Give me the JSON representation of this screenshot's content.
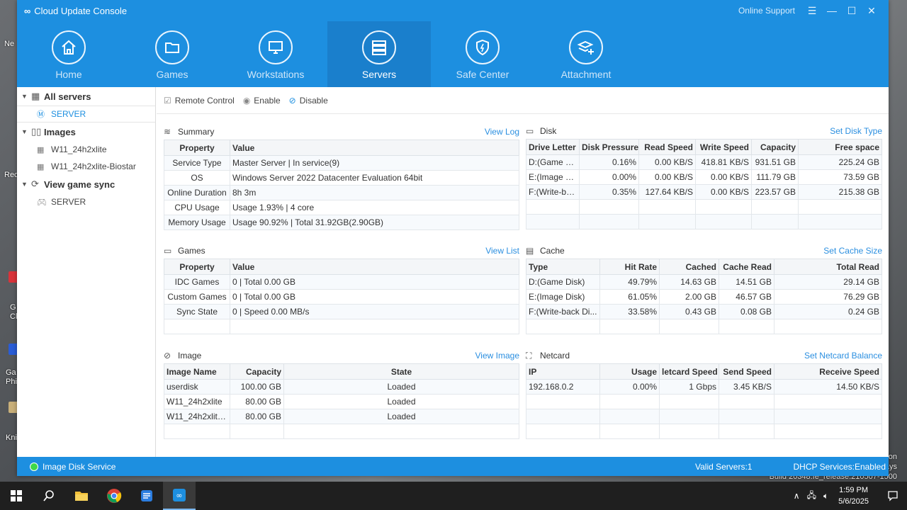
{
  "desktop": {
    "fragments": [
      "Ne",
      "Rec",
      "G",
      "Cl",
      "Ga",
      "Phi",
      "Kni"
    ],
    "watermark": [
      "tion",
      "days",
      "Build 20348.fe_release.210507-1500"
    ]
  },
  "titlebar": {
    "logo": "∞",
    "title": "Cloud Update Console",
    "support": "Online Support"
  },
  "nav": [
    {
      "label": "Home",
      "icon": "home-icon"
    },
    {
      "label": "Games",
      "icon": "folder-icon"
    },
    {
      "label": "Workstations",
      "icon": "monitor-icon"
    },
    {
      "label": "Servers",
      "icon": "server-icon"
    },
    {
      "label": "Safe Center",
      "icon": "shield-icon"
    },
    {
      "label": "Attachment",
      "icon": "layers-plus-icon"
    }
  ],
  "sidebar": {
    "groups": [
      {
        "label": "All servers",
        "items": [
          "SERVER"
        ]
      },
      {
        "label": "Images",
        "items": [
          "W11_24h2xlite",
          "W11_24h2xlite-Biostar"
        ]
      },
      {
        "label": "View game sync",
        "items": [
          "SERVER"
        ]
      }
    ]
  },
  "toolbar": {
    "remote": "Remote Control",
    "enable": "Enable",
    "disable": "Disable"
  },
  "summary": {
    "title": "Summary",
    "link": "View Log",
    "headers": [
      "Property",
      "Value"
    ],
    "rows": [
      [
        "Service Type",
        "Master Server | In service(9)"
      ],
      [
        "OS",
        "Windows Server 2022 Datacenter Evaluation 64bit"
      ],
      [
        "Online Duration",
        "8h 3m"
      ],
      [
        "CPU Usage",
        "Usage 1.93% | 4 core"
      ],
      [
        "Memory Usage",
        "Usage 90.92% | Total 31.92GB(2.90GB)"
      ]
    ]
  },
  "disk": {
    "title": "Disk",
    "link": "Set Disk Type",
    "headers": [
      "Drive Letter",
      "Disk Pressure",
      "Read Speed",
      "Write Speed",
      "Capacity",
      "Free space"
    ],
    "rows": [
      [
        "D:(Game D...",
        "0.16%",
        "0.00 KB/S",
        "418.81 KB/S",
        "931.51 GB",
        "225.24 GB"
      ],
      [
        "E:(Image D...",
        "0.00%",
        "0.00 KB/S",
        "0.00 KB/S",
        "111.79 GB",
        "73.59 GB"
      ],
      [
        "F:(Write-ba...",
        "0.35%",
        "127.64 KB/S",
        "0.00 KB/S",
        "223.57 GB",
        "215.38 GB"
      ]
    ]
  },
  "games": {
    "title": "Games",
    "link": "View List",
    "headers": [
      "Property",
      "Value"
    ],
    "rows": [
      [
        "IDC Games",
        "0 | Total 0.00 GB"
      ],
      [
        "Custom Games",
        "0 | Total 0.00 GB"
      ],
      [
        "Sync State",
        "0 | Speed 0.00 MB/s"
      ]
    ]
  },
  "cache": {
    "title": "Cache",
    "link": "Set Cache Size",
    "headers": [
      "Type",
      "Hit Rate",
      "Cached",
      "Cache Read",
      "Total Read"
    ],
    "rows": [
      [
        "D:(Game Disk)",
        "49.79%",
        "14.63 GB",
        "14.51 GB",
        "29.14 GB"
      ],
      [
        "E:(Image Disk)",
        "61.05%",
        "2.00 GB",
        "46.57 GB",
        "76.29 GB"
      ],
      [
        "F:(Write-back Di...",
        "33.58%",
        "0.43 GB",
        "0.08 GB",
        "0.24 GB"
      ]
    ]
  },
  "image": {
    "title": "Image",
    "link": "View Image",
    "headers": [
      "Image Name",
      "Capacity",
      "State"
    ],
    "rows": [
      [
        "userdisk",
        "100.00 GB",
        "Loaded"
      ],
      [
        "W11_24h2xlite",
        "80.00 GB",
        "Loaded"
      ],
      [
        "W11_24h2xlite...",
        "80.00 GB",
        "Loaded"
      ]
    ]
  },
  "netcard": {
    "title": "Netcard",
    "link": "Set Netcard Balance",
    "headers": [
      "IP",
      "Usage",
      "letcard Speed",
      "Send Speed",
      "Receive Speed"
    ],
    "rows": [
      [
        "192.168.0.2",
        "0.00%",
        "1 Gbps",
        "3.45 KB/S",
        "14.50 KB/S"
      ]
    ]
  },
  "status": {
    "service": "Image Disk Service",
    "valid": "Valid Servers:1",
    "dhcp": "DHCP Services:Enabled",
    "dot_color": "#3ed84a"
  },
  "taskbar": {
    "time": "1:59 PM",
    "date": "5/6/2025"
  },
  "colors": {
    "accent": "#1d8fe0",
    "link": "#2b8fe0"
  }
}
